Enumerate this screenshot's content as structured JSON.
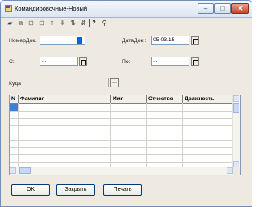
{
  "window": {
    "title": "Командировочные-Новый",
    "minimize": "–",
    "maximize": "□",
    "close": "✕"
  },
  "toolbar": {
    "items": [
      {
        "name": "save-icon",
        "glyph": "▰"
      },
      {
        "name": "copy-icon",
        "glyph": "⧉"
      },
      {
        "name": "add-row-icon",
        "glyph": "⊞"
      },
      {
        "name": "delete-row-icon",
        "glyph": "⊟"
      },
      {
        "name": "move-up-icon",
        "glyph": "⬆"
      },
      {
        "name": "move-down-icon",
        "glyph": "⬇"
      },
      {
        "name": "sort-asc-icon",
        "glyph": "⇅"
      },
      {
        "name": "sort-desc-icon",
        "glyph": "⇵"
      },
      {
        "name": "help-icon",
        "glyph": "?"
      },
      {
        "name": "filter-icon",
        "glyph": "⚲"
      }
    ]
  },
  "form": {
    "doc_number_label": "НомерДок.",
    "doc_number_value": "",
    "doc_date_label": "ДатаДок.:",
    "doc_date_value": "05.03.15",
    "from_label": "С:",
    "from_value": ". .",
    "to_label": "По:",
    "to_value": ". .",
    "where_label": "Куда",
    "where_value": "",
    "ellipsis": "..."
  },
  "table": {
    "columns": [
      "N",
      "Фамилия",
      "Имя",
      "Отчество",
      "Должность"
    ],
    "rows": []
  },
  "buttons": {
    "ok": "OK",
    "close": "Закрыть",
    "print": "Печать"
  },
  "colors": {
    "accent": "#0a64d8",
    "window_bg": "#eeeae2",
    "border": "#7f9db9"
  }
}
